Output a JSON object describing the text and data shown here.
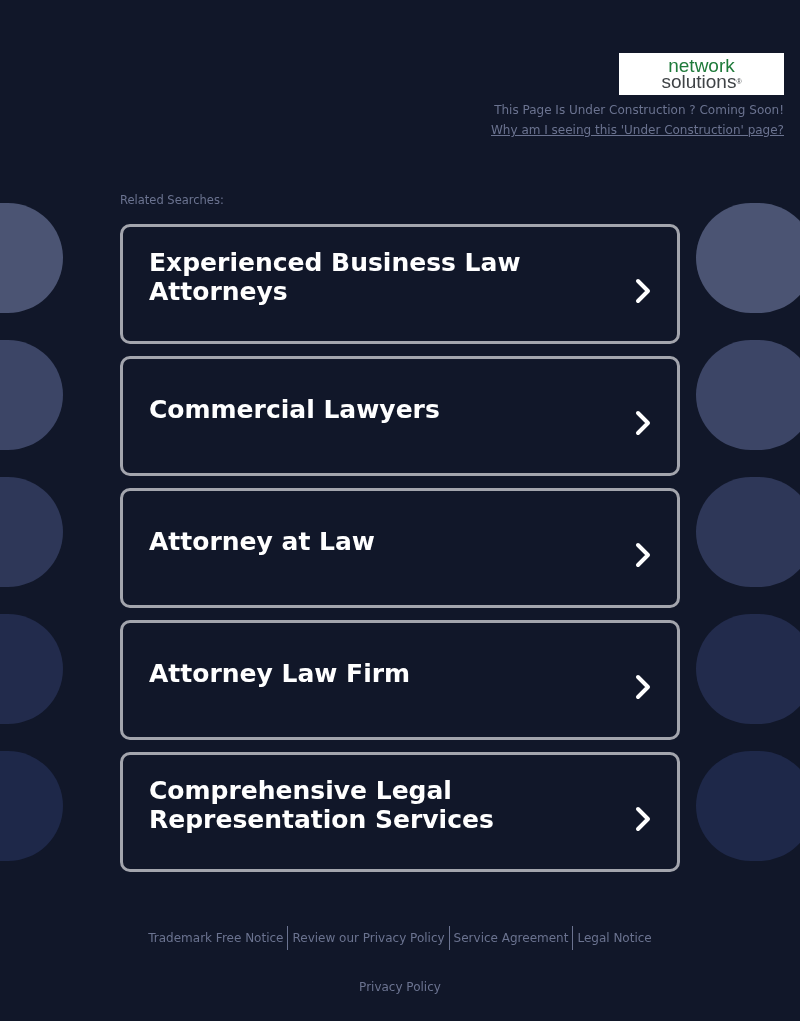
{
  "logo": {
    "line1": "network",
    "line2": "solutions",
    "mark": "®"
  },
  "notice": "This Page Is Under Construction ? Coming Soon!",
  "why_link": "Why am I seeing this 'Under Construction' page?",
  "related_label": "Related Searches:",
  "searches": [
    "Experienced Business Law Attorneys",
    "Commercial Lawyers",
    "Attorney at Law",
    "Attorney Law Firm",
    "Comprehensive Legal Representation Services"
  ],
  "footer_links": [
    "Trademark Free Notice",
    "Review our Privacy Policy",
    "Service Agreement",
    "Legal Notice"
  ],
  "privacy": "Privacy Policy"
}
